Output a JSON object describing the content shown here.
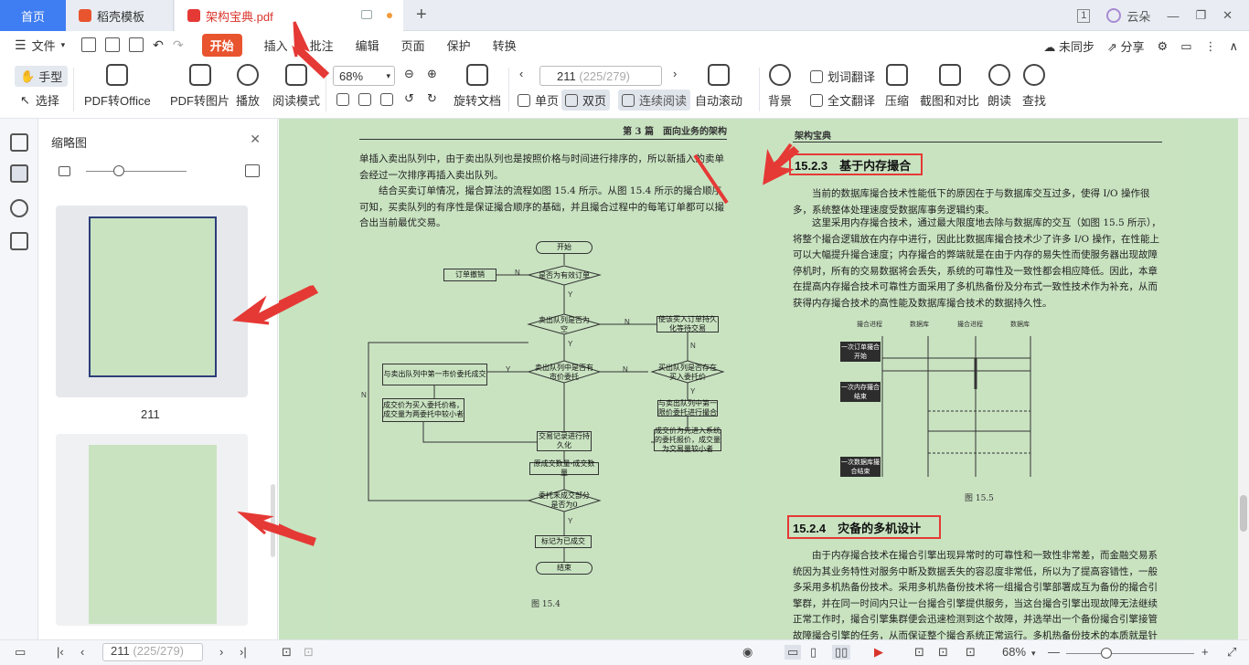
{
  "tabs": {
    "home": "首页",
    "template": "稻壳模板",
    "active": "架构宝典.pdf",
    "page_count_badge": "1",
    "user": "云朵"
  },
  "menu": {
    "file": "文件",
    "items": [
      "开始",
      "插入",
      "批注",
      "编辑",
      "页面",
      "保护",
      "转换"
    ],
    "sync": "未同步",
    "share": "分享"
  },
  "toolbar": {
    "hand": "手型",
    "select": "选择",
    "pdf_office": "PDF转Office",
    "pdf_image": "PDF转图片",
    "play": "播放",
    "read_mode": "阅读模式",
    "zoom": "68%",
    "rotate": "旋转文档",
    "page_input": "211",
    "page_total": "(225/279)",
    "single": "单页",
    "double": "双页",
    "continuous": "连续阅读",
    "auto_scroll": "自动滚动",
    "background": "背景",
    "word_translate": "划词翻译",
    "full_translate": "全文翻译",
    "compress": "压缩",
    "screenshot": "截图和对比",
    "read_aloud": "朗读",
    "find": "查找"
  },
  "thumbs": {
    "title": "缩略图",
    "page1": "211"
  },
  "left_page": {
    "header": "第 3 篇　面向业务的架构",
    "p1": "单插入卖出队列中，由于卖出队列也是按照价格与时间进行排序的，所以新插入的卖单会经过一次排序再插入卖出队列。",
    "p2": "结合买卖订单情况，撮合算法的流程如图 15.4 所示。从图 15.4 所示的撮合顺序可知，买卖队列的有序性是保证撮合顺序的基础，并且撮合过程中的每笔订单都可以撮合出当前最优交易。",
    "figure": "图 15.4",
    "flow": {
      "start": "开始",
      "q1": "是否为有效订单",
      "cancel": "订单撤销",
      "q2": "卖出队列是否为空",
      "persist_buy": "使该买入订单持久化等待交易",
      "q3": "卖出队列中是否有市价委托",
      "q4": "买出队列是否存在买入委托价",
      "match1": "与卖出队列中第一市价委托成交",
      "match2": "与卖出队列中第一限价委托进行撮合",
      "price1": "成交价为买入委托价格，成交量为两委托中较小者",
      "price2": "成交价为先进入系统的委托报价，成交量为交易量较小者",
      "record": "交易记录进行持久化",
      "vol": "原成交数量-成交数量",
      "q5": "委托未成交部分是否为0",
      "mark": "标记为已成交",
      "end": "结束",
      "y": "Y",
      "n": "N"
    }
  },
  "right_page": {
    "header": "架构宝典",
    "h1": "15.2.3　基于内存撮合",
    "p1": "当前的数据库撮合技术性能低下的原因在于与数据库交互过多，使得 I/O 操作很多，系统整体处理速度受数据库事务逻辑约束。",
    "p2": "这里采用内存撮合技术，通过最大限度地去除与数据库的交互（如图 15.5 所示），将整个撮合逻辑放在内存中进行，因此比数据库撮合技术少了许多 I/O 操作，在性能上可以大幅提升撮合速度；内存撮合的弊端就是在由于内存的易失性而使服务器出现故障停机时，所有的交易数据将会丢失，系统的可靠性及一致性都会相应降低。因此，本章在提高内存撮合技术可靠性方面采用了多机热备份及分布式一致性技术作为补充，从而获得内存撮合技术的高性能及数据库撮合技术的数据持久性。",
    "diagram": {
      "cols": [
        "撮合进程",
        "数据库",
        "撮合进程",
        "数据库"
      ],
      "boxes": [
        "一次订单撮合开始",
        "一次内存撮合结束",
        "一次数据库撮合结束"
      ]
    },
    "figure": "图 15.5",
    "h2": "15.2.4　灾备的多机设计",
    "p3": "由于内存撮合技术在撮合引擎出现异常时的可靠性和一致性非常差，而金融交易系统因为其业务特性对服务中断及数据丢失的容忍度非常低，所以为了提高容错性，一般多采用多机热备份技术。采用多机热备份技术将一组撮合引擎部署成互为备份的撮合引擎群，并在同一时间内只让一台撮合引擎提供服务，当这台撮合引擎出现故障无法继续正常工作时，撮合引擎集群便会迅速检测到这个故障，并选举出一个备份撮合引擎接管故障撮合引擎的任务，从而保证整个撮合系统正常运行。多机热备份技术的本质就是针对服务器临时"
  },
  "status": {
    "page_input": "211",
    "page_total": "(225/279)",
    "zoom": "68%"
  },
  "colors": {
    "accent": "#e8542e",
    "brand": "#3f7df2",
    "page_bg": "#c9e3c1",
    "highlight": "#e53935"
  }
}
